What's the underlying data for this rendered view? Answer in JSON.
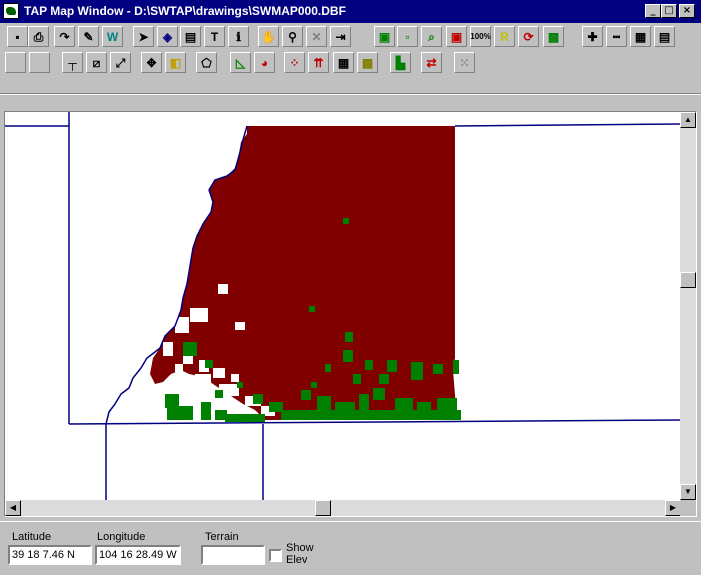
{
  "window": {
    "title": "TAP Map Window - D:\\SWTAP\\drawings\\SWMAP000.DBF",
    "controls": {
      "minimize": "_",
      "maximize": "□",
      "close": "×"
    }
  },
  "toolbar": {
    "row1": [
      {
        "name": "save-icon",
        "glyph": "▪",
        "color": "#000"
      },
      {
        "name": "print-icon",
        "glyph": "⎙",
        "color": "#000"
      },
      {
        "name": "redo-arrow-icon",
        "glyph": "↷",
        "color": "#000"
      },
      {
        "name": "edit-document-icon",
        "glyph": "✎",
        "color": "#000"
      },
      {
        "name": "w-icon",
        "glyph": "W",
        "color": "#008080"
      },
      {
        "name": "pointer-icon",
        "glyph": "➤",
        "color": "#000"
      },
      {
        "name": "layer-icon",
        "glyph": "◈",
        "color": "#000080"
      },
      {
        "name": "database-icon",
        "glyph": "▤",
        "color": "#000"
      },
      {
        "name": "text-tool-icon",
        "glyph": "T",
        "color": "#000"
      },
      {
        "name": "info-icon",
        "glyph": "ℹ",
        "color": "#000"
      },
      {
        "name": "pan-icon",
        "glyph": "✋",
        "color": "#000"
      },
      {
        "name": "find-icon",
        "glyph": "⚲",
        "color": "#000"
      },
      {
        "name": "delete-icon",
        "glyph": "✕",
        "color": "#808080"
      },
      {
        "name": "exit-icon",
        "glyph": "⇥",
        "color": "#000"
      },
      {
        "name": "green-zoom-icon",
        "glyph": "▣",
        "color": "#008000"
      },
      {
        "name": "green-small-icon",
        "glyph": "▫",
        "color": "#008000"
      },
      {
        "name": "magnify-icon",
        "glyph": "⌕",
        "color": "#008000"
      },
      {
        "name": "red-zoom-icon",
        "glyph": "▣",
        "color": "#c00000"
      },
      {
        "name": "zoom-100-icon",
        "glyph": "100%",
        "color": "#000"
      },
      {
        "name": "r-icon",
        "glyph": "R",
        "color": "#c0c000"
      },
      {
        "name": "refresh-icon",
        "glyph": "⟳",
        "color": "#c00000"
      },
      {
        "name": "grid-zoom-icon",
        "glyph": "▩",
        "color": "#008000"
      },
      {
        "name": "crosshair-icon",
        "glyph": "✚",
        "color": "#000"
      },
      {
        "name": "ruler-icon",
        "glyph": "┅",
        "color": "#000"
      },
      {
        "name": "table-icon",
        "glyph": "▦",
        "color": "#000"
      },
      {
        "name": "notes-icon",
        "glyph": "▤",
        "color": "#000"
      }
    ],
    "row2": [
      {
        "name": "blank-icon",
        "glyph": "",
        "color": "#000"
      },
      {
        "name": "blank-icon",
        "glyph": "",
        "color": "#000"
      },
      {
        "name": "line-tool-icon",
        "glyph": "┬",
        "color": "#000"
      },
      {
        "name": "select-box-icon",
        "glyph": "⧄",
        "color": "#000"
      },
      {
        "name": "resize-icon",
        "glyph": "⤢",
        "color": "#000"
      },
      {
        "name": "move-icon",
        "glyph": "✥",
        "color": "#000"
      },
      {
        "name": "overlay-icon",
        "glyph": "◧",
        "color": "#c0a000"
      },
      {
        "name": "polygon-icon",
        "glyph": "⬠",
        "color": "#000"
      },
      {
        "name": "area-icon",
        "glyph": "◺",
        "color": "#008000"
      },
      {
        "name": "pie-icon",
        "glyph": "◕",
        "color": "#c00000"
      },
      {
        "name": "points-icon",
        "glyph": "⁘",
        "color": "#c00000"
      },
      {
        "name": "vector-icon",
        "glyph": "⇈",
        "color": "#c00000"
      },
      {
        "name": "grid-icon",
        "glyph": "▦",
        "color": "#000"
      },
      {
        "name": "color-grid-icon",
        "glyph": "▩",
        "color": "#808000"
      },
      {
        "name": "histogram-icon",
        "glyph": "▙",
        "color": "#008000"
      },
      {
        "name": "transfer-icon",
        "glyph": "⇄",
        "color": "#c00000"
      },
      {
        "name": "disabled-grid-icon",
        "glyph": "⁙",
        "color": "#808080"
      }
    ]
  },
  "status_bar": {
    "latitude": {
      "label": "Latitude",
      "value": "39 18 7.46 N"
    },
    "longitude": {
      "label": "Longitude",
      "value": "104 16 28.49 W"
    },
    "terrain": {
      "label": "Terrain",
      "value": ""
    },
    "show_elev": {
      "label_line1": "Show",
      "label_line2": "Elev",
      "checked": false
    }
  },
  "map": {
    "colors": {
      "background": "#ffffff",
      "terrain_dark_red": "#800000",
      "vegetation_green": "#008000",
      "boundary_navy": "#000080"
    },
    "scroll": {
      "vertical_arrows": [
        "▲",
        "▼"
      ],
      "horizontal_arrows": [
        "◀",
        "▶"
      ]
    }
  }
}
